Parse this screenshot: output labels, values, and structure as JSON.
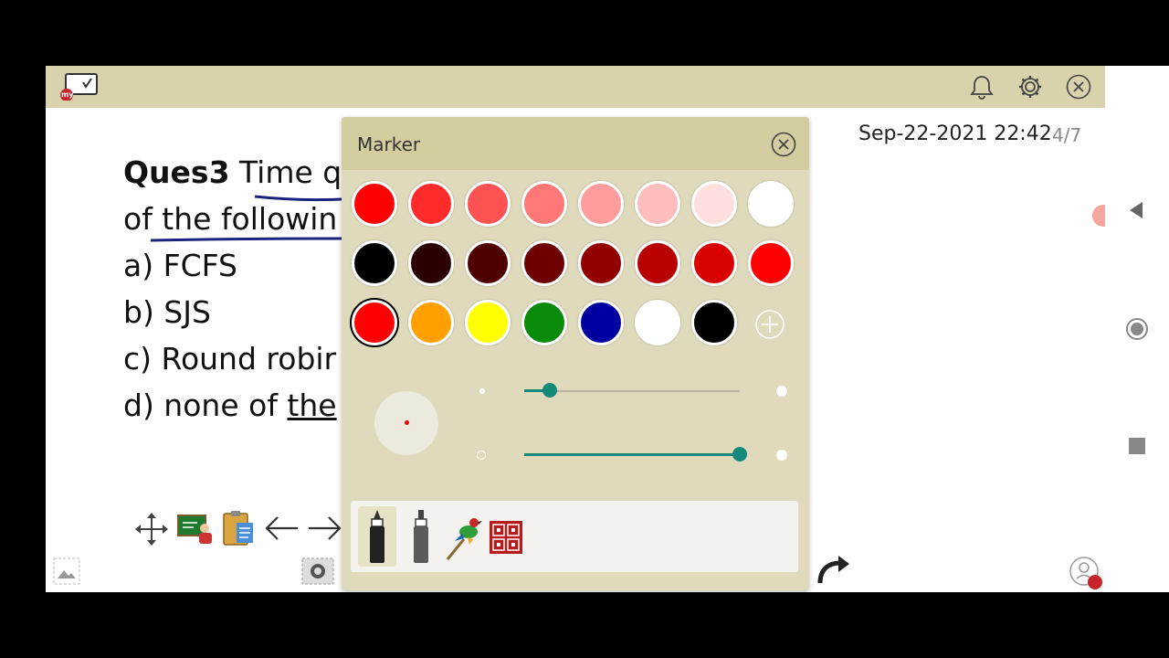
{
  "app": {
    "logo_badge": "my",
    "notification_icon": "bell-icon",
    "settings_icon": "gear-icon",
    "close_icon": "close-circle-icon"
  },
  "board": {
    "question_label": "Ques3",
    "question_text": " Time q",
    "line2": "of the followin",
    "option_a": "a) FCFS",
    "option_b": "b) SJS",
    "option_c": "c) Round robir",
    "option_d_prefix": "d) none of ",
    "option_d_word": "the"
  },
  "status": {
    "timestamp": "Sep-22-2021 22:42",
    "page": "4/7"
  },
  "marker_panel": {
    "title": "Marker",
    "swatch_rows": [
      [
        "#ff0000",
        "#ff2b2b",
        "#ff5252",
        "#ff7878",
        "#ff9c9c",
        "#ffbcbc",
        "#ffdede",
        "#ffffff"
      ],
      [
        "#000000",
        "#2b0000",
        "#4f0000",
        "#6f0000",
        "#930000",
        "#b80000",
        "#d90000",
        "#ff0000"
      ],
      [
        "#ff0000",
        "#ff9f00",
        "#ffff00",
        "#098a09",
        "#0000a0",
        "#ffffff",
        "#000000"
      ]
    ],
    "selected_swatch": "#ff0000",
    "size_slider": 0.12,
    "opacity_slider": 1.0,
    "tools": [
      "marker-pen-icon",
      "highlighter-icon",
      "brush-bird-icon",
      "pattern-icon"
    ]
  },
  "toolbar": {
    "icons": [
      "move-icon",
      "teacher-board-icon",
      "clipboard-icon",
      "arrow-left-icon",
      "arrow-right-icon"
    ]
  },
  "colors": {
    "header_bg": "#d9d3ad",
    "panel_bg": "#dfdabb",
    "accent": "#168a7a"
  }
}
